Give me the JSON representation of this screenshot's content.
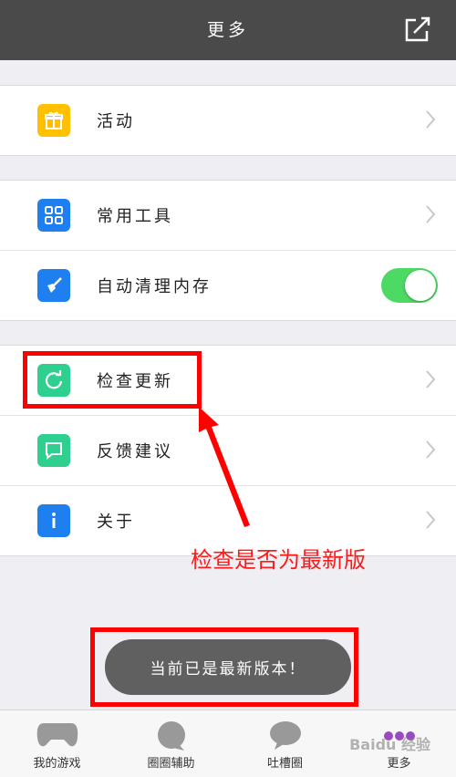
{
  "header": {
    "title": "更多",
    "share_icon": "share-icon"
  },
  "groups": [
    {
      "items": [
        {
          "label": "活动",
          "icon": "gift-icon",
          "color": "#ffc000"
        }
      ]
    },
    {
      "items": [
        {
          "label": "常用工具",
          "icon": "grid-icon",
          "color": "#1e80f0"
        },
        {
          "label": "自动清理内存",
          "icon": "broom-icon",
          "color": "#1e80f0",
          "toggle": true
        }
      ]
    },
    {
      "items": [
        {
          "label": "检查更新",
          "icon": "refresh-icon",
          "color": "#2ecf8f"
        },
        {
          "label": "反馈建议",
          "icon": "message-icon",
          "color": "#2ecf8f"
        },
        {
          "label": "关于",
          "icon": "info-icon",
          "color": "#1e80f0"
        }
      ]
    }
  ],
  "annotation": {
    "text": "检查是否为最新版",
    "color": "#ff0000"
  },
  "toast": {
    "text": "当前已是最新版本！"
  },
  "tabbar": [
    {
      "label": "我的游戏",
      "icon": "gamepad-icon"
    },
    {
      "label": "圈圈辅助",
      "icon": "chat-bubble-icon"
    },
    {
      "label": "吐槽圈",
      "icon": "speech-bubble-icon"
    },
    {
      "label": "更多",
      "icon": "more-icon"
    }
  ],
  "watermark": {
    "text": "Baidu 经验"
  }
}
